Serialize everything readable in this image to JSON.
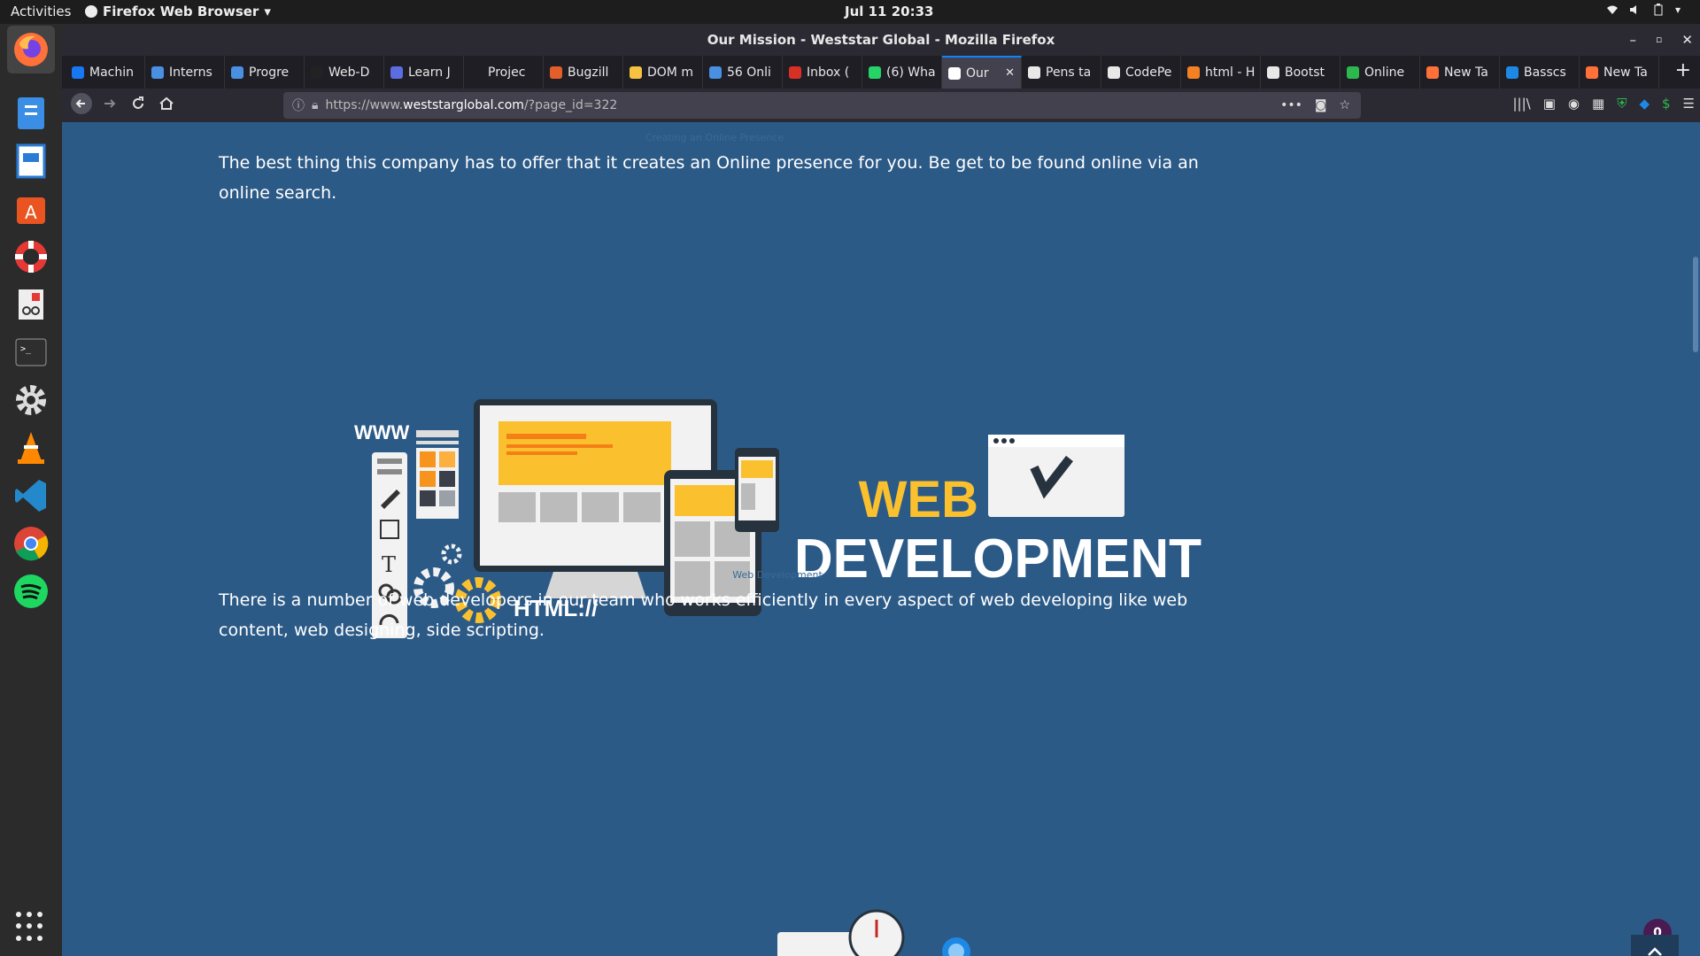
{
  "system": {
    "activities": "Activities",
    "app_menu": "Firefox Web Browser",
    "clock": "Jul 11  20:33"
  },
  "dock": {
    "items": [
      "firefox",
      "file-manager",
      "writer",
      "software-center",
      "help",
      "screenshot-viewer",
      "terminal",
      "settings",
      "vlc",
      "vscode",
      "chrome",
      "spotify"
    ]
  },
  "window": {
    "title": "Our Mission - Weststar Global - Mozilla Firefox"
  },
  "tabs": [
    {
      "label": "Machin",
      "color": "#1877f2"
    },
    {
      "label": "Interns",
      "color": "#4a90e2"
    },
    {
      "label": "Progre",
      "color": "#4a90e2"
    },
    {
      "label": "Web-D",
      "color": "#222222"
    },
    {
      "label": "Learn J",
      "color": "#5b6ee1"
    },
    {
      "label": "Projec",
      "color": "#1f1e25"
    },
    {
      "label": "Bugzill",
      "color": "#e25f2b"
    },
    {
      "label": "DOM m",
      "color": "#f5c242"
    },
    {
      "label": "56 Onli",
      "color": "#4a90e2"
    },
    {
      "label": "Inbox (",
      "color": "#d93025"
    },
    {
      "label": "(6) Wha",
      "color": "#25d366"
    },
    {
      "label": "Our",
      "color": "#ffffff",
      "active": true
    },
    {
      "label": "Pens ta",
      "color": "#e8e8e8"
    },
    {
      "label": "CodePe",
      "color": "#e8e8e8"
    },
    {
      "label": "html - H",
      "color": "#f48024"
    },
    {
      "label": "Bootst",
      "color": "#e8e8e8"
    },
    {
      "label": "Online",
      "color": "#2db84d"
    },
    {
      "label": "New Ta",
      "color": "#ff7139"
    },
    {
      "label": "Basscs",
      "color": "#1e88e5"
    },
    {
      "label": "New Ta",
      "color": "#ff7139"
    }
  ],
  "urlbar": {
    "prefix": "https://www.",
    "host": "weststarglobal.com",
    "path": "/?page_id=322"
  },
  "page": {
    "caption_top": "Creating an Online Presence",
    "para1": "The best thing this company has to offer that it creates an Online presence for you. Be get to be found online via an online search.",
    "hero_word1": "WEB",
    "hero_word2": "DEVELOPMENT",
    "hero_html": "HTML://",
    "hero_www": "WWW",
    "caption_mid": "Web Development",
    "para2": "There is a number of web developers in our team who works efficiently in every aspect of web developing like web content, web designing, side scripting.",
    "badge_count": "0"
  }
}
